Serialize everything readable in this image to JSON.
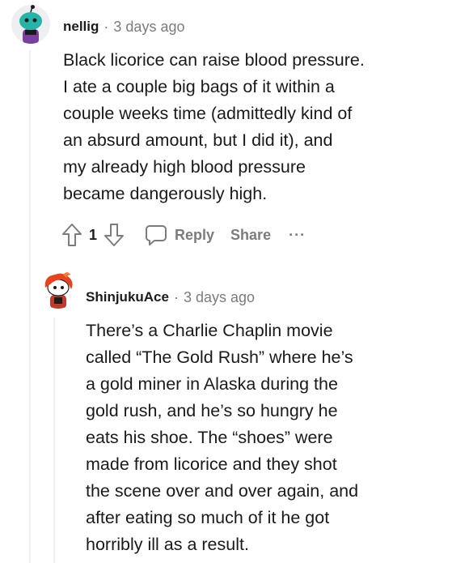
{
  "comments": [
    {
      "username": "nellig",
      "separator": "·",
      "time": "3 days ago",
      "lines": [
        "Black licorice can raise blood pressure.",
        "I ate a couple big bags of it within a",
        "couple weeks time (admittedly kind of",
        "an absurd amount, but I did it), and",
        "my already high blood pressure",
        "became dangerously high."
      ],
      "votes": "1",
      "reply_label": "Reply",
      "share_label": "Share",
      "more_label": "···"
    },
    {
      "username": "ShinjukuAce",
      "separator": "·",
      "time": "3 days ago",
      "lines": [
        "There’s a Charlie Chaplin movie",
        "called “The Gold Rush” where he’s",
        "a gold miner in Alaska during the",
        "gold rush, and he’s so hungry he",
        "eats his shoe. The “shoes” were",
        "made from licorice and they shot",
        "the scene over and over again, and",
        "after eating so much of it he got",
        "horribly ill as a result."
      ]
    }
  ],
  "icons": {
    "upvote": "upvote-arrow-icon",
    "downvote": "downvote-arrow-icon",
    "reply": "speech-bubble-icon",
    "avatar1": "snoo-avatar-teal",
    "avatar2": "snoo-avatar-red-hair"
  }
}
